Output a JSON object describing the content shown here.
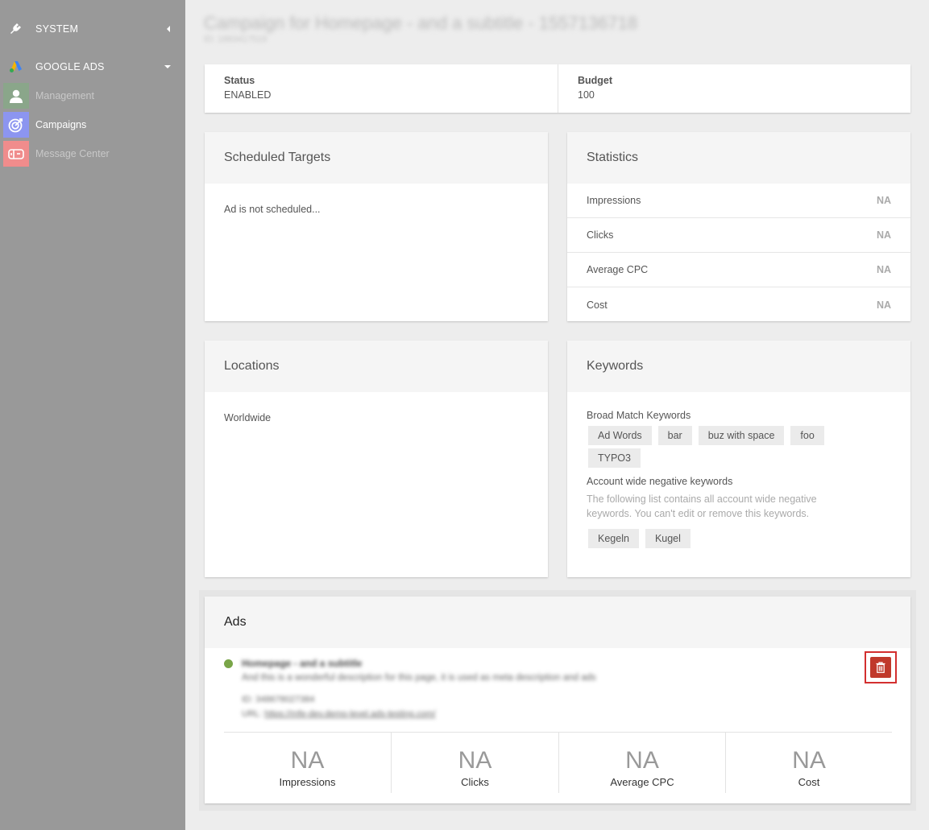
{
  "sidebar": {
    "system_label": "SYSTEM",
    "google_ads_label": "GOOGLE ADS",
    "items": [
      {
        "label": "Management",
        "icon": "user-icon",
        "color": "#8aa68a"
      },
      {
        "label": "Campaigns",
        "icon": "target-icon",
        "color": "#8c95f0"
      },
      {
        "label": "Message Center",
        "icon": "mailbox-icon",
        "color": "#f08c8c"
      }
    ]
  },
  "header": {
    "title": "Campaign for Homepage - and a subtitle - 1557136718",
    "subtitle": "ID: 1883417519"
  },
  "summary": {
    "status_label": "Status",
    "status_value": "ENABLED",
    "budget_label": "Budget",
    "budget_value": "100"
  },
  "scheduled": {
    "title": "Scheduled Targets",
    "empty_text": "Ad is not scheduled..."
  },
  "statistics": {
    "title": "Statistics",
    "rows": [
      {
        "label": "Impressions",
        "value": "NA"
      },
      {
        "label": "Clicks",
        "value": "NA"
      },
      {
        "label": "Average CPC",
        "value": "NA"
      },
      {
        "label": "Cost",
        "value": "NA"
      }
    ]
  },
  "locations": {
    "title": "Locations",
    "value": "Worldwide"
  },
  "keywords": {
    "title": "Keywords",
    "broad_label": "Broad Match Keywords",
    "broad": [
      "Ad Words",
      "bar",
      "buz with space",
      "foo",
      "TYPO3"
    ],
    "negative_label": "Account wide negative keywords",
    "negative_desc": "The following list contains all account wide negative keywords. You can't edit or remove this keywords.",
    "negative": [
      "Kegeln",
      "Kugel"
    ]
  },
  "ads": {
    "title": "Ads",
    "status_color": "#79a548",
    "ad": {
      "headline": "Homepage - and a subtitle",
      "description": "And this is a wonderful description for this page, it is used as meta description and ads",
      "id_line": "ID: 348678027384",
      "url_prefix": "URL:",
      "url": "https://mfe-dev.demo-level.ads-testing.com/"
    },
    "metrics": [
      {
        "value": "NA",
        "label": "Impressions"
      },
      {
        "value": "NA",
        "label": "Clicks"
      },
      {
        "value": "NA",
        "label": "Average CPC"
      },
      {
        "value": "NA",
        "label": "Cost"
      }
    ]
  }
}
